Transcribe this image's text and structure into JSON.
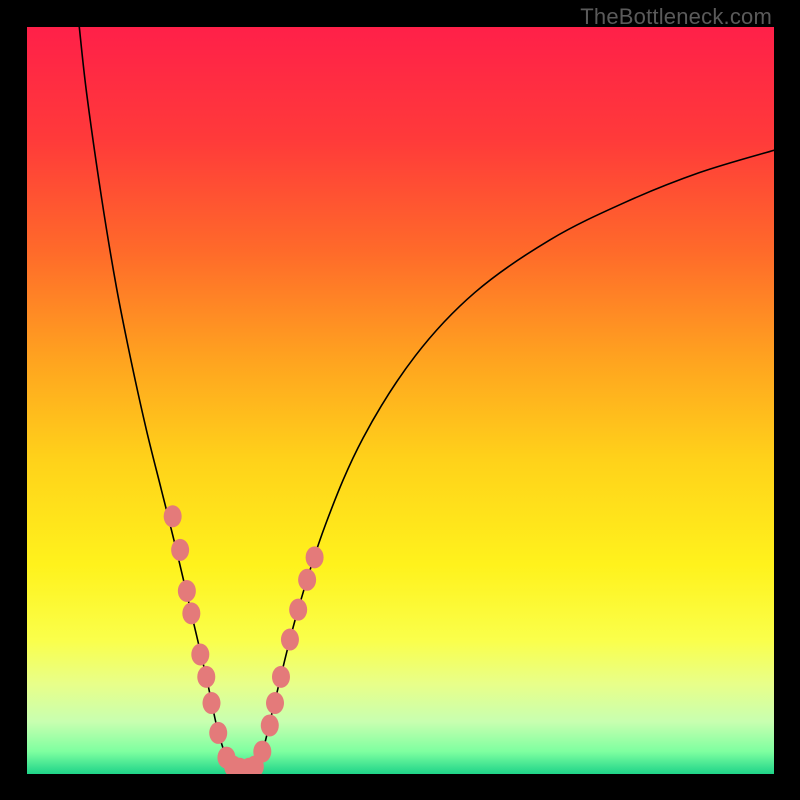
{
  "watermark": "TheBottleneck.com",
  "chart_data": {
    "type": "line",
    "title": "",
    "xlabel": "",
    "ylabel": "",
    "xlim": [
      0,
      100
    ],
    "ylim": [
      0,
      100
    ],
    "grid": false,
    "annotations": [],
    "gradient_stops": [
      {
        "pos": 0.0,
        "color": "#ff2049"
      },
      {
        "pos": 0.15,
        "color": "#ff3a3a"
      },
      {
        "pos": 0.3,
        "color": "#ff6a2a"
      },
      {
        "pos": 0.45,
        "color": "#ffa51f"
      },
      {
        "pos": 0.58,
        "color": "#ffd21a"
      },
      {
        "pos": 0.72,
        "color": "#fff21c"
      },
      {
        "pos": 0.82,
        "color": "#faff4a"
      },
      {
        "pos": 0.88,
        "color": "#e8ff8a"
      },
      {
        "pos": 0.93,
        "color": "#c8ffb0"
      },
      {
        "pos": 0.97,
        "color": "#7effa0"
      },
      {
        "pos": 1.0,
        "color": "#1fd489"
      }
    ],
    "series": [
      {
        "name": "left-curve",
        "type": "curve",
        "stroke": "#000000",
        "points": [
          {
            "x": 7.0,
            "y": 100.0
          },
          {
            "x": 8.0,
            "y": 91.0
          },
          {
            "x": 10.0,
            "y": 77.0
          },
          {
            "x": 12.0,
            "y": 65.0
          },
          {
            "x": 14.0,
            "y": 55.0
          },
          {
            "x": 16.0,
            "y": 46.0
          },
          {
            "x": 18.0,
            "y": 38.0
          },
          {
            "x": 20.0,
            "y": 30.0
          },
          {
            "x": 22.0,
            "y": 21.5
          },
          {
            "x": 24.0,
            "y": 13.0
          },
          {
            "x": 25.5,
            "y": 6.0
          },
          {
            "x": 27.0,
            "y": 1.5
          },
          {
            "x": 28.0,
            "y": 0.5
          }
        ]
      },
      {
        "name": "right-curve",
        "type": "curve",
        "stroke": "#000000",
        "points": [
          {
            "x": 30.0,
            "y": 0.5
          },
          {
            "x": 31.5,
            "y": 3.0
          },
          {
            "x": 33.0,
            "y": 9.0
          },
          {
            "x": 36.0,
            "y": 21.0
          },
          {
            "x": 40.0,
            "y": 33.5
          },
          {
            "x": 45.0,
            "y": 45.0
          },
          {
            "x": 52.0,
            "y": 56.0
          },
          {
            "x": 60.0,
            "y": 64.5
          },
          {
            "x": 70.0,
            "y": 71.5
          },
          {
            "x": 80.0,
            "y": 76.5
          },
          {
            "x": 90.0,
            "y": 80.5
          },
          {
            "x": 100.0,
            "y": 83.5
          }
        ]
      },
      {
        "name": "left-dots",
        "type": "scatter",
        "fill": "#e47a7a",
        "stroke": "#c95a5a",
        "points": [
          {
            "x": 19.5,
            "y": 34.5
          },
          {
            "x": 20.5,
            "y": 30.0
          },
          {
            "x": 21.4,
            "y": 24.5
          },
          {
            "x": 22.0,
            "y": 21.5
          },
          {
            "x": 23.2,
            "y": 16.0
          },
          {
            "x": 24.0,
            "y": 13.0
          },
          {
            "x": 24.7,
            "y": 9.5
          },
          {
            "x": 25.6,
            "y": 5.5
          },
          {
            "x": 26.7,
            "y": 2.2
          },
          {
            "x": 27.6,
            "y": 1.0
          },
          {
            "x": 28.5,
            "y": 0.7
          }
        ]
      },
      {
        "name": "right-dots",
        "type": "scatter",
        "fill": "#e47a7a",
        "stroke": "#c95a5a",
        "points": [
          {
            "x": 29.7,
            "y": 0.7
          },
          {
            "x": 30.5,
            "y": 1.0
          },
          {
            "x": 31.5,
            "y": 3.0
          },
          {
            "x": 32.5,
            "y": 6.5
          },
          {
            "x": 33.2,
            "y": 9.5
          },
          {
            "x": 34.0,
            "y": 13.0
          },
          {
            "x": 35.2,
            "y": 18.0
          },
          {
            "x": 36.3,
            "y": 22.0
          },
          {
            "x": 37.5,
            "y": 26.0
          },
          {
            "x": 38.5,
            "y": 29.0
          }
        ]
      }
    ]
  }
}
